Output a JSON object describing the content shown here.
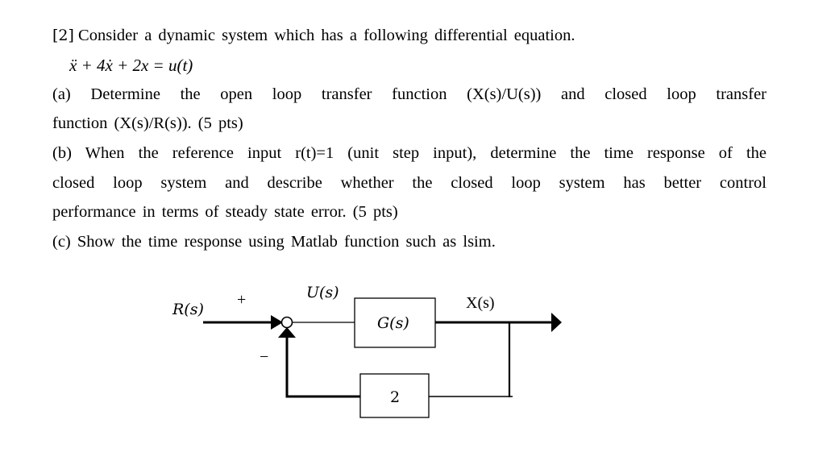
{
  "problem": {
    "heading_number": "[2]",
    "intro": "Consider a dynamic system which has a following differential equation.",
    "equation": {
      "lhs_terms": [
        "ẍ",
        "+ 4ẋ",
        "+ 2x"
      ],
      "equals": "=",
      "rhs": "u(t)",
      "full": "ẍ + 4ẋ + 2x = u(t)"
    },
    "part_a": {
      "line1": "(a) Determine the open loop transfer function (X(s)/U(s)) and closed loop transfer",
      "line2": "function (X(s)/R(s)). (5 pts)"
    },
    "part_b": {
      "line1": "(b) When the reference input r(t)=1 (unit step input), determine the time response of the",
      "line2": "closed loop system and describe whether the closed loop system has better control",
      "line3": "performance in terms of steady state error. (5 pts)"
    },
    "part_c": {
      "line1": "(c) Show the time response using Matlab function such as lsim."
    }
  },
  "diagram": {
    "input_label": "R(s)",
    "plus_sign": "+",
    "minus_sign": "−",
    "control_label": "U(s)",
    "forward_block": "G(s)",
    "output_label": "X(s)",
    "feedback_block": "2",
    "line_color": "#000000"
  }
}
